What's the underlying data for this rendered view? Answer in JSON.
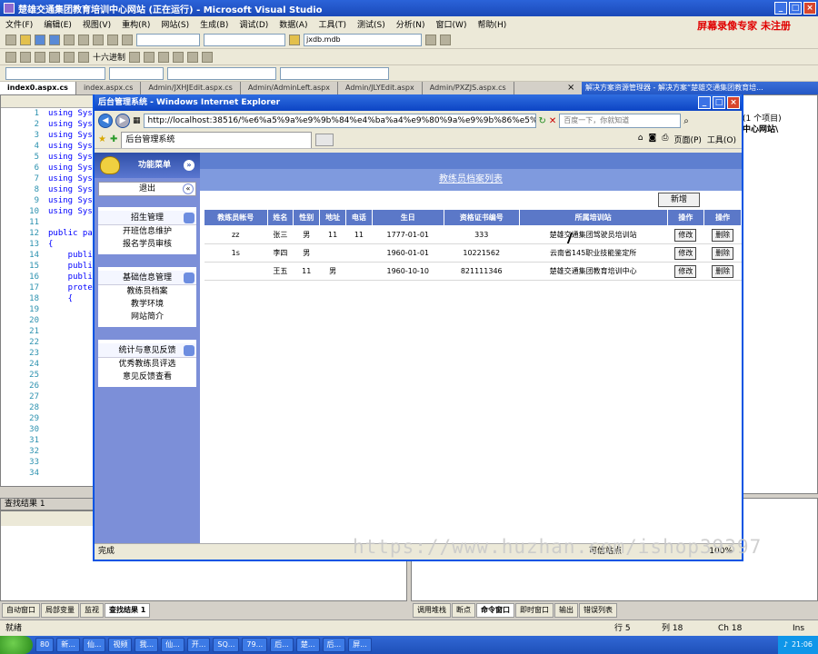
{
  "vs": {
    "title": "楚雄交通集团教育培训中心网站 (正在运行) - Microsoft Visual Studio",
    "menu": [
      "文件(F)",
      "编辑(E)",
      "视图(V)",
      "重构(R)",
      "网站(S)",
      "生成(B)",
      "调试(D)",
      "数据(A)",
      "工具(T)",
      "测试(S)",
      "分析(N)",
      "窗口(W)",
      "帮助(H)"
    ],
    "toolbar_db": "jxdb.mdb",
    "toolbar_hex": "十六进制",
    "doc_tabs": [
      "index0.aspx.cs",
      "index.aspx.cs",
      "Admin/JXHJEdit.aspx.cs",
      "Admin/AdminLeft.aspx",
      "Admin/JLYEdit.aspx",
      "Admin/PXZJS.aspx.cs"
    ],
    "line_numbers": [
      "1",
      "2",
      "3",
      "4",
      "5",
      "6",
      "7",
      "8",
      "9",
      "10",
      "11",
      "12",
      "13",
      "14",
      "15",
      "16",
      "17",
      "18",
      "19",
      "20",
      "21",
      "22",
      "23",
      "24",
      "25",
      "26",
      "27",
      "28",
      "29",
      "30",
      "31",
      "32",
      "33",
      "34"
    ],
    "code_lines": [
      "using Sys",
      "using Sys",
      "using Sys",
      "using Sys",
      "using Sys",
      "using Sys",
      "using Sys",
      "using Sys",
      "using Sys",
      "using Sys",
      "",
      "public pa",
      "{",
      "    publi",
      "    publi",
      "    publi",
      "    prote",
      "    {"
    ],
    "solution_title": "解决方案资源管理器 - 解决方案“楚雄交通集团教育培...",
    "solution_lines": [
      "(1 个项目)",
      "中心网站\\"
    ],
    "find_title": "查找结果 1",
    "bottom_tabs_left": [
      "自动窗口",
      "局部变量",
      "监视",
      "查找结果 1"
    ],
    "bottom_tabs_right": [
      "调用堆栈",
      "断点",
      "命令窗口",
      "即时窗口",
      "输出",
      "错误列表"
    ],
    "status": {
      "text": "就绪",
      "row": "行 5",
      "col": "列 18",
      "ch": "Ch 18",
      "ins": "Ins"
    },
    "watermark_top": "屏幕录像专家 未注册"
  },
  "ie": {
    "title": "后台管理系统 - Windows Internet Explorer",
    "url": "http://localhost:38516/%e6%a5%9a%e9%9b%84%e4%ba%a4%e9%80%9a%e9%9b%86%e5%9b%a2",
    "search_placeholder": "百度一下，你就知道",
    "tab_title": "后台管理系统",
    "tools": [
      "页面(P)",
      "工具(O)"
    ],
    "status_text": "完成",
    "zone": "可信站点",
    "zoom": "100%"
  },
  "sidebar": {
    "menu_title": "功能菜单",
    "logout": "退出",
    "groups": [
      {
        "title": "招生管理",
        "items": [
          "开班信息维护",
          "报名学员审核"
        ]
      },
      {
        "title": "基础信息管理",
        "items": [
          "教练员档案",
          "教学环境",
          "网站简介"
        ]
      },
      {
        "title": "统计与意见反馈",
        "items": [
          "优秀教练员评选",
          "意见反馈查看"
        ]
      }
    ]
  },
  "main": {
    "list_title": "教练员档案列表",
    "new_button": "新增",
    "columns": [
      "教练员帐号",
      "姓名",
      "性别",
      "地址",
      "电话",
      "生日",
      "资格证书编号",
      "所属培训站",
      "操作",
      "操作"
    ],
    "rows": [
      [
        "zz",
        "张三",
        "男",
        "11",
        "11",
        "1777-01-01",
        "333",
        "楚雄交通集团驾驶员培训站"
      ],
      [
        "1s",
        "李四",
        "男",
        "",
        "",
        "1960-01-01",
        "10221562",
        "云南省145职业技能鉴定所"
      ],
      [
        "",
        "王五",
        "11",
        "男",
        "",
        "1960-10-10",
        "821111346",
        "楚雄交通集团教育培训中心"
      ]
    ],
    "edit_label": "修改",
    "delete_label": "删除"
  },
  "taskbar": {
    "buttons": [
      "80",
      "新...",
      "仙...",
      "视频",
      "我...",
      "仙...",
      "开...",
      "SQ...",
      "79...",
      "后...",
      "楚...",
      "后...",
      "屏..."
    ],
    "clock": "21:06"
  },
  "watermark": "https://www.huzhan.com/ishop39397"
}
